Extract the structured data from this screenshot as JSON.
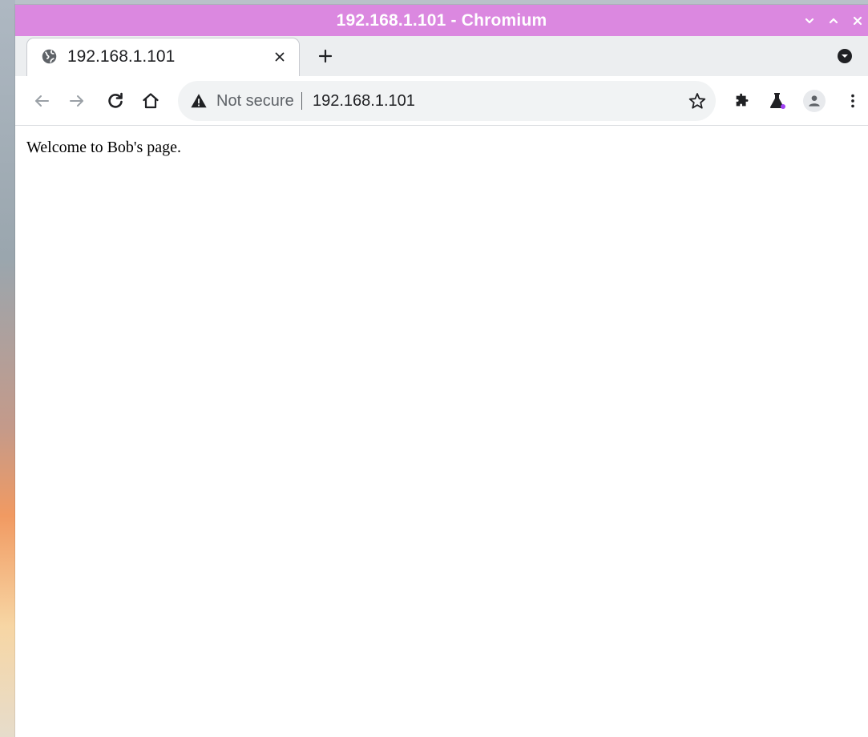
{
  "window": {
    "title": "192.168.1.101 - Chromium",
    "titlebar_color": "#db88e0"
  },
  "tab": {
    "title": "192.168.1.101",
    "favicon": "globe-icon"
  },
  "omnibox": {
    "security_label": "Not secure",
    "url": "192.168.1.101"
  },
  "page": {
    "text": "Welcome to Bob's page."
  },
  "icons": {
    "back": "back-arrow-icon",
    "forward": "forward-arrow-icon",
    "reload": "reload-icon",
    "home": "home-icon",
    "warning": "warning-icon",
    "bookmark": "star-icon",
    "extensions": "puzzle-icon",
    "labs": "flask-icon",
    "profile": "avatar-icon",
    "menu": "kebab-menu-icon",
    "minimize": "chevron-down-icon",
    "maximize": "chevron-up-icon",
    "close": "close-icon"
  }
}
